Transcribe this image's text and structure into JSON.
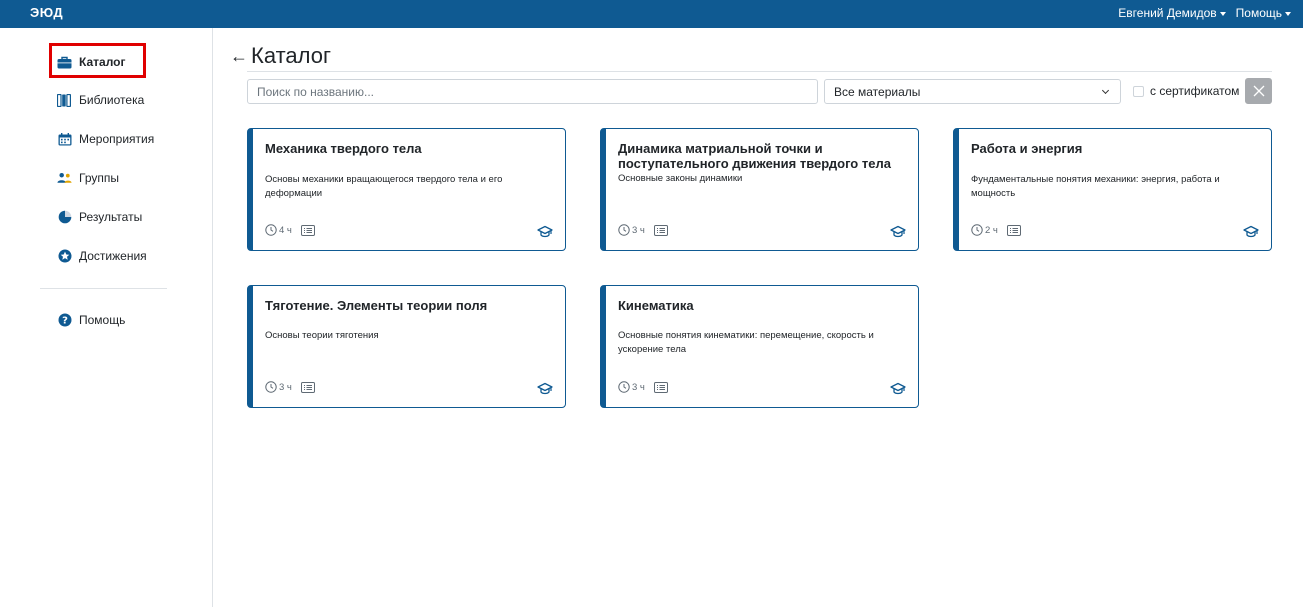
{
  "header": {
    "logo": "ЭЮД",
    "user_menu": "Евгений Демидов",
    "help_menu": "Помощь"
  },
  "sidebar": {
    "items": [
      {
        "label": "Каталог",
        "icon": "briefcase-icon",
        "active": true
      },
      {
        "label": "Библиотека",
        "icon": "books-icon"
      },
      {
        "label": "Мероприятия",
        "icon": "calendar-icon"
      },
      {
        "label": "Группы",
        "icon": "users-icon"
      },
      {
        "label": "Результаты",
        "icon": "pie-chart-icon"
      },
      {
        "label": "Достижения",
        "icon": "star-badge-icon"
      }
    ],
    "help": {
      "label": "Помощь",
      "icon": "question-circle-icon"
    }
  },
  "main": {
    "title": "Каталог",
    "search": {
      "placeholder": "Поиск по названию...",
      "value": ""
    },
    "filter": {
      "selected": "Все материалы"
    },
    "certificate_filter": {
      "label": "с сертификатом",
      "checked": false
    }
  },
  "cards": [
    {
      "title": "Механика твердого тела",
      "description": "Основы механики вращающегося твердого тела и его деформации",
      "duration": "4 ч"
    },
    {
      "title": "Динамика матриальной точки и поступательного движения твердого тела",
      "description": "Основные законы динамики",
      "duration": "3 ч"
    },
    {
      "title": "Работа и энергия",
      "description": "Фундаментальные понятия механики: энергия, работа и мощность",
      "duration": "2 ч"
    },
    {
      "title": "Тяготение. Элементы теории поля",
      "description": "Основы теории тяготения",
      "duration": "3 ч"
    },
    {
      "title": "Кинематика",
      "description": "Основные понятия кинематики: перемещение, скорость и ускорение тела",
      "duration": "3 ч"
    }
  ],
  "colors": {
    "brand": "#0f5a92",
    "highlight": "#e00000",
    "clear_button": "#a7aaae"
  }
}
